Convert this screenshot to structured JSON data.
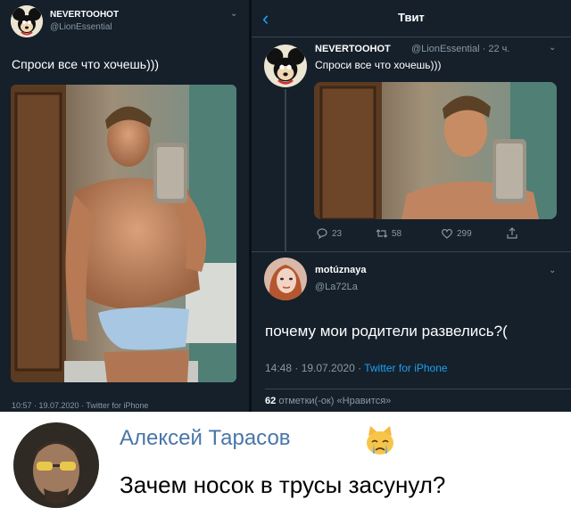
{
  "left_panel": {
    "author_name": "NEVERTOOHOT",
    "author_handle": "@LionEssential",
    "tweet_text": "Спроси все что хочешь)))",
    "timestamp_cut": "10:57 · 19.07.2020 · Twitter for iPhone"
  },
  "right_panel": {
    "header_title": "Твит",
    "author_name": "NEVERTOOHOT",
    "author_meta": "@LionEssential · 22 ч.",
    "tweet_text": "Спроси все что хочешь)))",
    "stats": {
      "replies": "23",
      "retweets": "58",
      "likes": "299"
    },
    "reply": {
      "author_name": "motúznaya",
      "author_handle": "@La72La",
      "text": "почему мои родители развелись?(",
      "timestamp": "14:48 · 19.07.2020 · ",
      "client": "Twitter for iPhone",
      "likes_count": "62",
      "likes_label": "отметки(-ок) «Нравится»"
    }
  },
  "comment": {
    "author_name": "Алексей Тарасов",
    "text": "Зачем носок в трусы засунул?",
    "emoji": "crying-cat-icon"
  },
  "colors": {
    "twitter_bg": "#15202b",
    "twitter_blue": "#1da1f2",
    "muted": "#8899a6",
    "vk_link": "#4a76a8"
  }
}
